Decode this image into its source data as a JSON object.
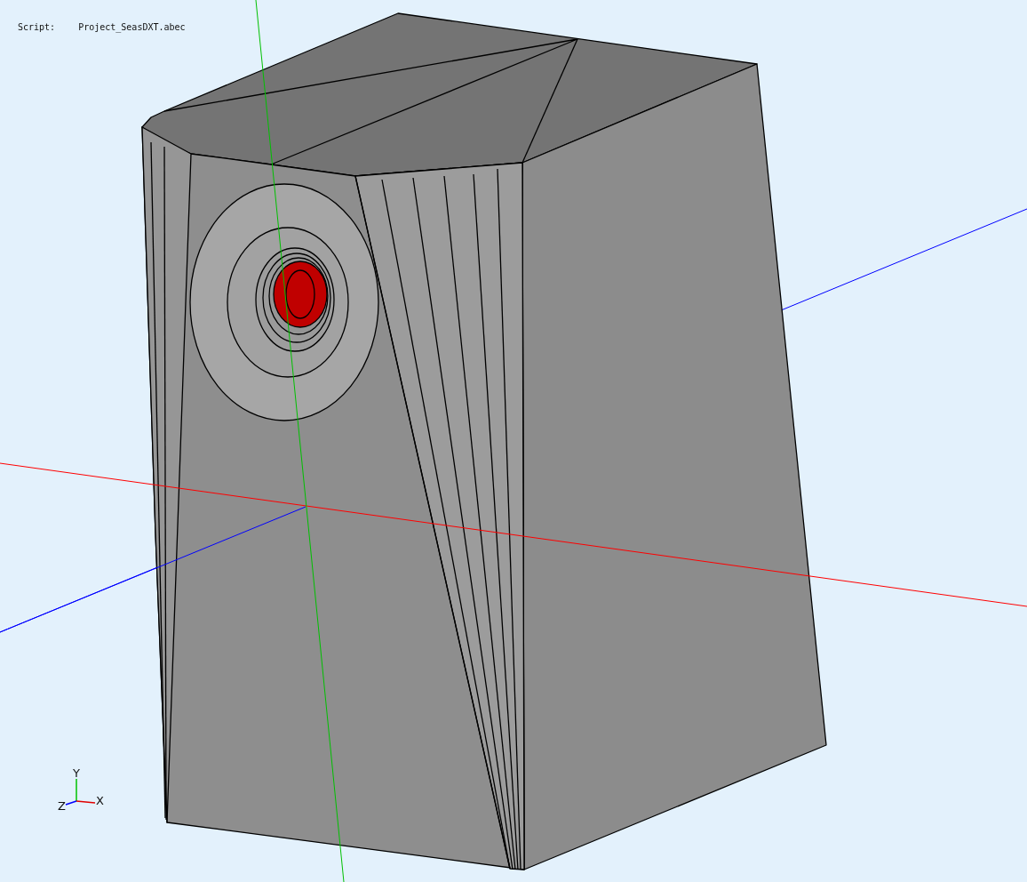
{
  "script": {
    "label": "Script:",
    "file": "Project_SeasDXT.abec"
  },
  "axis_triad": {
    "x": "X",
    "y": "Y",
    "z": "Z"
  }
}
